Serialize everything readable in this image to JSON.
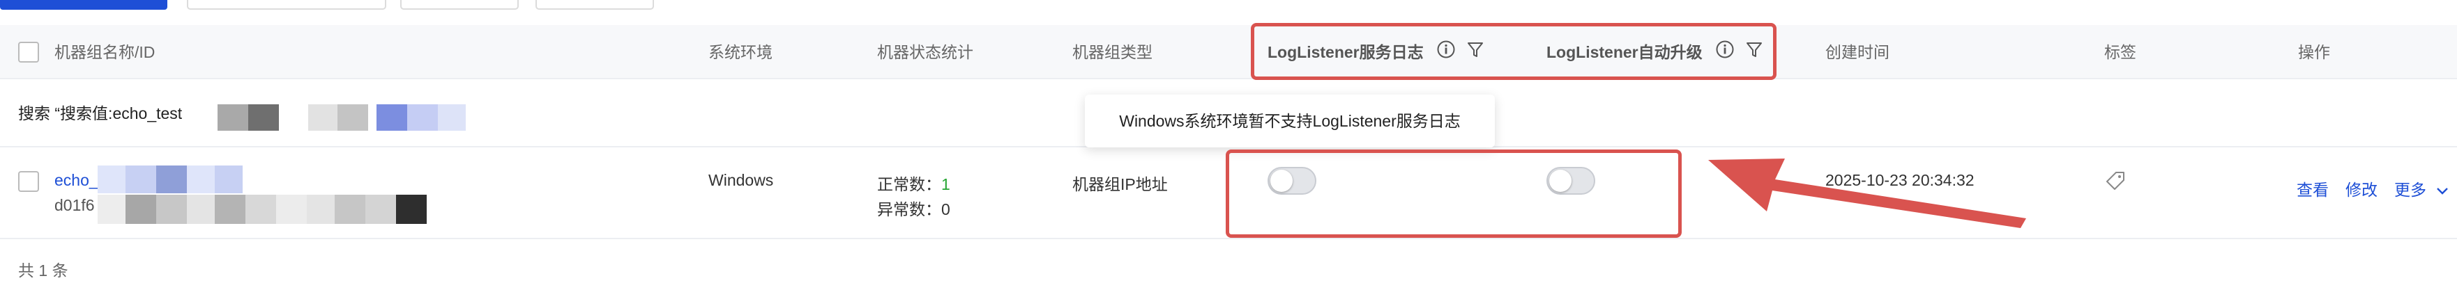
{
  "toolbar": {},
  "table": {
    "headers": {
      "name": "机器组名称/ID",
      "env": "系统环境",
      "stats": "机器状态统计",
      "type": "机器组类型",
      "log_service": "LogListener服务日志",
      "auto_upgrade": "LogListener自动升级",
      "created": "创建时间",
      "tags": "标签",
      "actions": "操作"
    },
    "search_label": "搜索 “搜索值:echo_test",
    "row": {
      "name_prefix": "echo_",
      "id_prefix": "d01f6",
      "env": "Windows",
      "normal_label": "正常数：",
      "normal_value": "1",
      "abnormal_label": "异常数：",
      "abnormal_value": "0",
      "type": "机器组IP地址",
      "created": "2025-10-23 20:34:32",
      "action_view": "查看",
      "action_edit": "修改",
      "action_more": "更多"
    },
    "total": "共 1 条"
  },
  "tooltip": {
    "text": "Windows系统环境暂不支持LogListener服务日志"
  },
  "colors": {
    "accent": "#1e4fd6",
    "annotation": "#d9534f",
    "success": "#25a532"
  },
  "icons": [
    "info-icon",
    "filter-icon",
    "tag-icon",
    "chevron-down-icon"
  ]
}
